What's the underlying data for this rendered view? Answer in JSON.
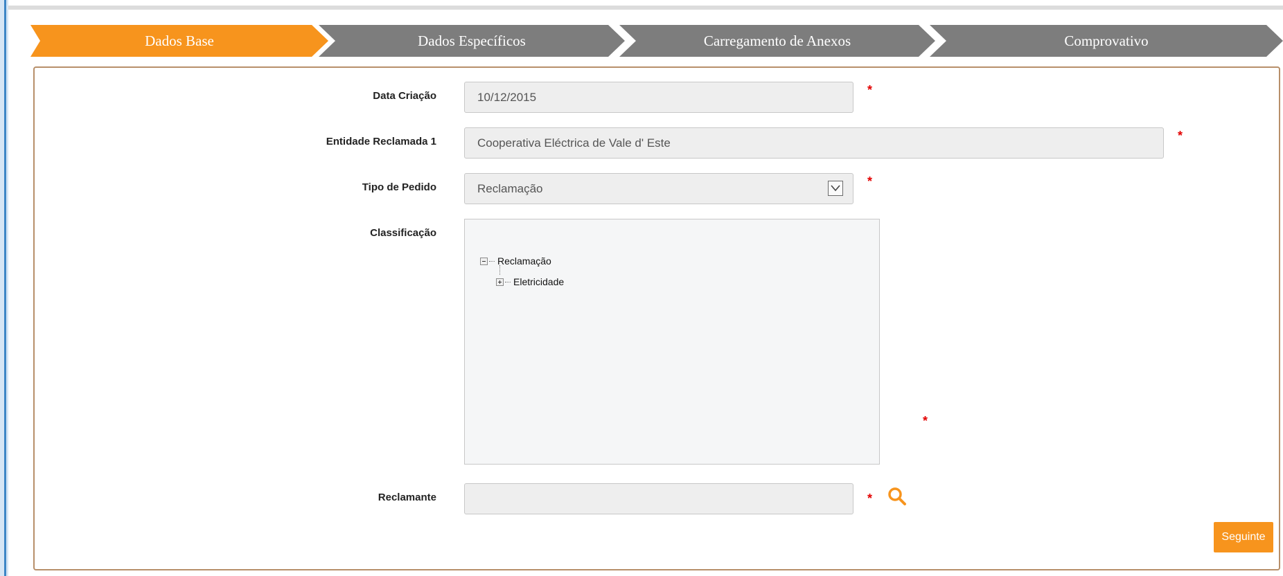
{
  "colors": {
    "active_step": "#f7941d",
    "inactive_step": "#7d7d7d",
    "required": "#e30000",
    "panel_border": "#b78f6a",
    "button": "#f7941d"
  },
  "wizard": {
    "steps": [
      {
        "label": "Dados Base",
        "active": true
      },
      {
        "label": "Dados Específicos",
        "active": false
      },
      {
        "label": "Carregamento de Anexos",
        "active": false
      },
      {
        "label": "Comprovativo",
        "active": false
      }
    ]
  },
  "form": {
    "data_criacao": {
      "label": "Data Criação",
      "value": "10/12/2015",
      "required": "*"
    },
    "entidade": {
      "label": "Entidade Reclamada 1",
      "value": "Cooperativa Eléctrica de Vale d' Este",
      "required": "*"
    },
    "tipo_pedido": {
      "label": "Tipo de Pedido",
      "value": "Reclamação",
      "required": "*"
    },
    "classificacao": {
      "label": "Classificação",
      "required": "*",
      "tree": [
        {
          "label": "Reclamação",
          "state": "expanded"
        },
        {
          "label": "Eletricidade",
          "state": "collapsed"
        }
      ]
    },
    "reclamante": {
      "label": "Reclamante",
      "value": "",
      "required": "*",
      "icon": "search-icon"
    }
  },
  "actions": {
    "next_label": "Seguinte"
  }
}
